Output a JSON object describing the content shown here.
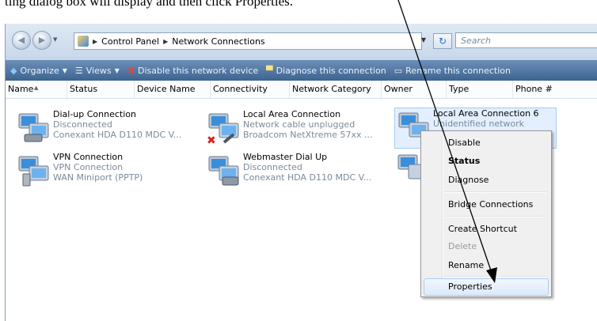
{
  "caption": "ting dialog box will display and then click Properties.",
  "address": {
    "crumbs": [
      "Control Panel",
      "Network Connections"
    ],
    "search_placeholder": "Search"
  },
  "toolbar": {
    "organize": "Organize",
    "views": "Views",
    "disable": "Disable this network device",
    "diagnose": "Diagnose this connection",
    "rename": "Rename this connection"
  },
  "columns": [
    "Name",
    "Status",
    "Device Name",
    "Connectivity",
    "Network Category",
    "Owner",
    "Type",
    "Phone #"
  ],
  "items": [
    {
      "name": "Dial-up Connection",
      "line2": "Disconnected",
      "line3": "Conexant HDA D110 MDC V..."
    },
    {
      "name": "Local Area Connection",
      "line2": "Network cable unplugged",
      "line3": "Broadcom NetXtreme 57xx ..."
    },
    {
      "name": "Local Area Connection 6",
      "line2": "Unidentified network",
      "line3": ""
    },
    {
      "name": "VPN Connection",
      "line2": "VPN Connection",
      "line3": "WAN Miniport (PPTP)"
    },
    {
      "name": "Webmaster Dial Up",
      "line2": "Disconnected",
      "line3": "Conexant HDA D110 MDC V..."
    }
  ],
  "menu": {
    "disable": "Disable",
    "status": "Status",
    "diagnose": "Diagnose",
    "bridge": "Bridge Connections",
    "create_shortcut": "Create Shortcut",
    "delete": "Delete",
    "rename": "Rename",
    "properties": "Properties"
  },
  "colors": {
    "toolbar": "#4a6f9c",
    "menu_highlight": "#dce9fb",
    "disabled_text": "#9a9a9a"
  }
}
